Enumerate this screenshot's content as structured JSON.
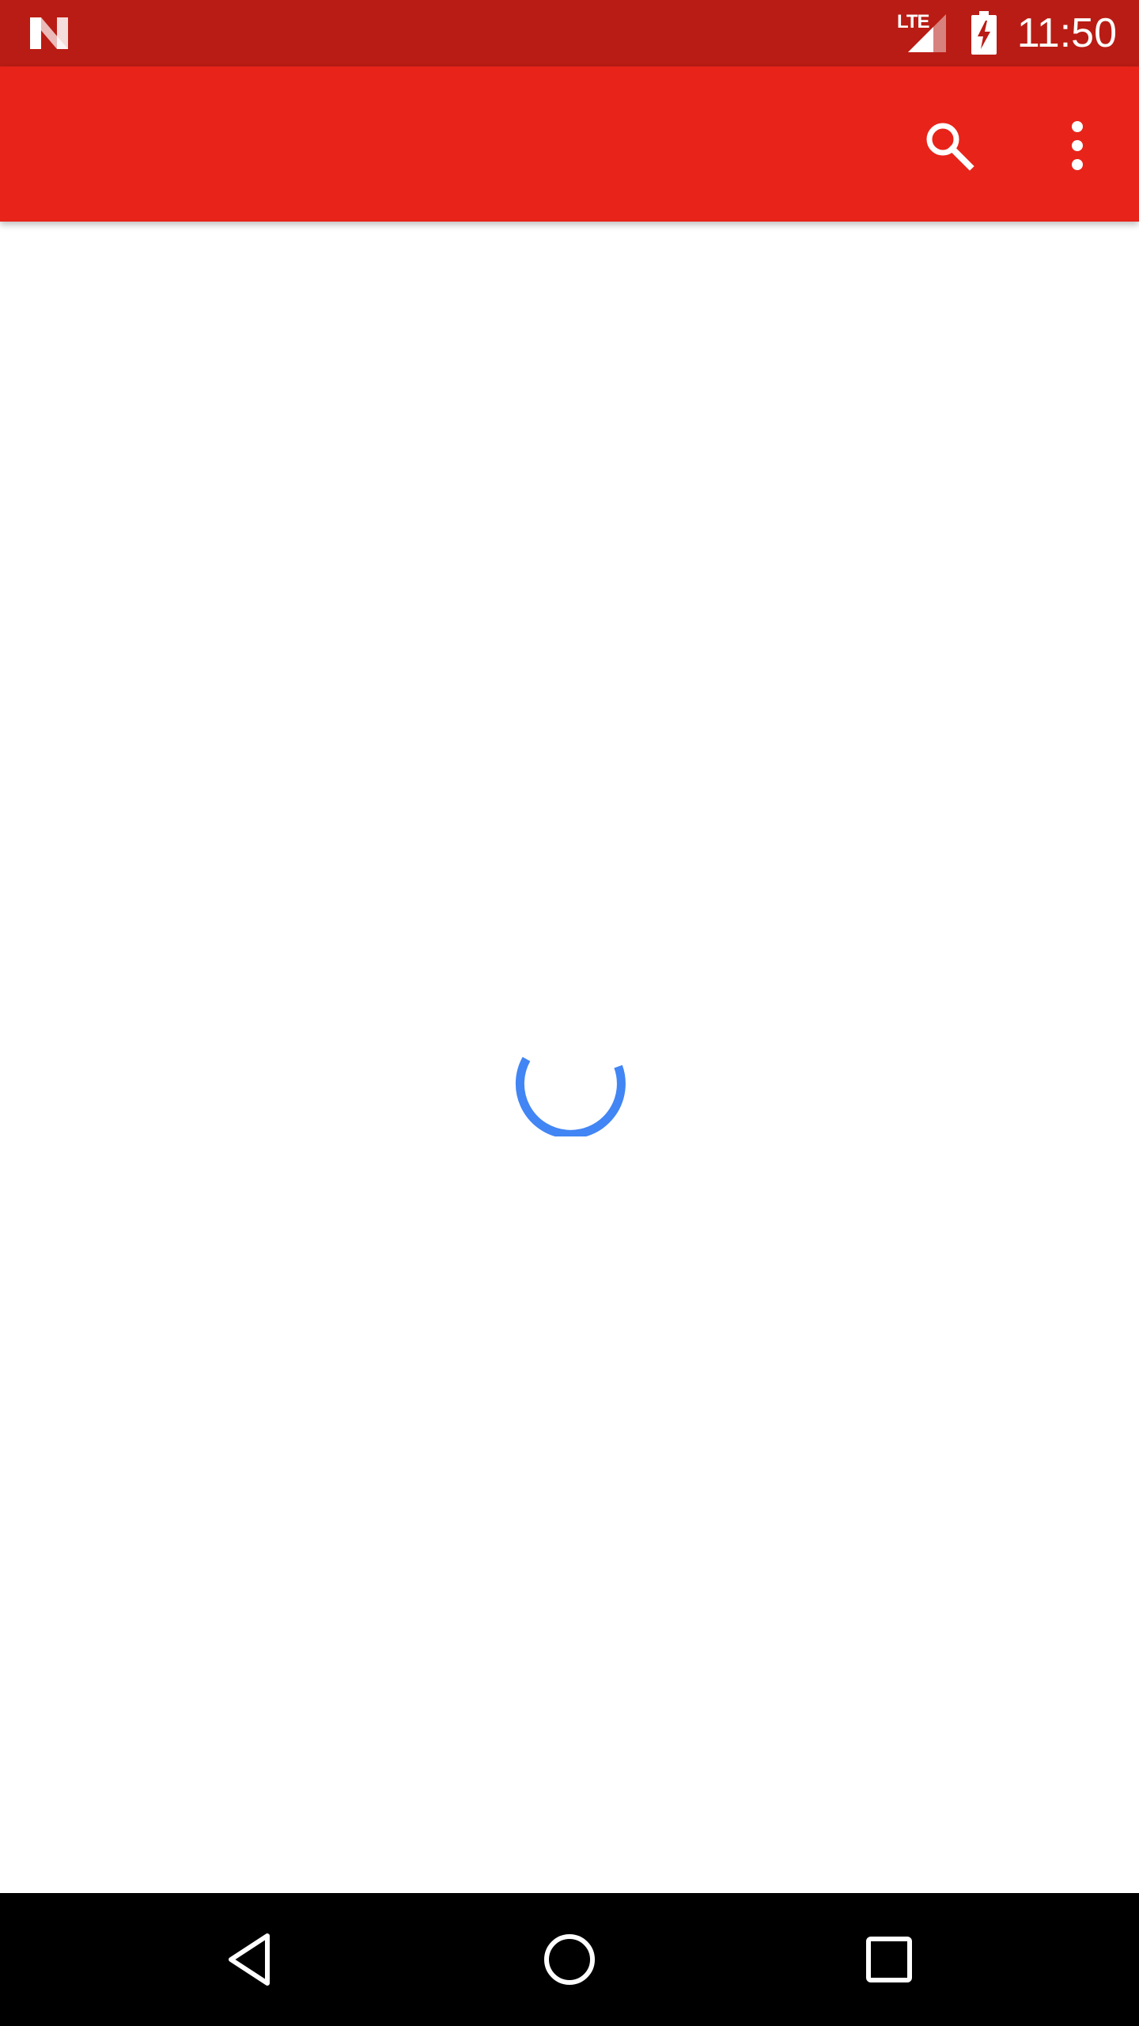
{
  "status_bar": {
    "time": "11:50",
    "network_label": "LTE",
    "icons": [
      "notification-n-icon",
      "signal-icon",
      "battery-charging-icon"
    ],
    "background_color": "#b91c14"
  },
  "app_bar": {
    "background_color": "#e8231a",
    "actions": [
      "search-icon",
      "more-vert-icon"
    ]
  },
  "content": {
    "loading_indicator": "progress-spinner",
    "spinner_color": "#4285f4"
  },
  "nav_bar": {
    "buttons": [
      "back-icon",
      "home-icon",
      "recents-icon"
    ]
  }
}
